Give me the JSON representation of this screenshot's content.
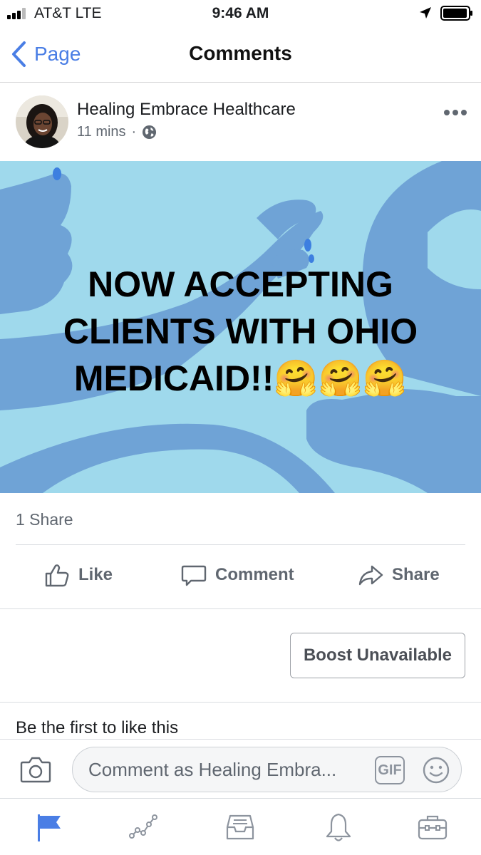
{
  "status_bar": {
    "carrier": "AT&T  LTE",
    "time": "9:46 AM"
  },
  "nav": {
    "back_label": "Page",
    "title": "Comments"
  },
  "post": {
    "page_name": "Healing Embrace Healthcare",
    "time_ago": "11 mins",
    "separator": "·",
    "image_text_lines": [
      "NOW ACCEPTING",
      "CLIENTS WITH OHIO",
      "MEDICAID!!🤗🤗🤗"
    ],
    "share_count": "1 Share"
  },
  "actions": {
    "like": "Like",
    "comment": "Comment",
    "share": "Share"
  },
  "boost": {
    "label": "Boost Unavailable"
  },
  "likes_line": "Be the first to like this",
  "composer": {
    "placeholder": "Comment as Healing Embra...",
    "gif_label": "GIF"
  },
  "tabs": [
    {
      "icon": "flag-icon",
      "active": true
    },
    {
      "icon": "insights-icon",
      "active": false
    },
    {
      "icon": "inbox-icon",
      "active": false
    },
    {
      "icon": "bell-icon",
      "active": false
    },
    {
      "icon": "briefcase-icon",
      "active": false
    }
  ],
  "colors": {
    "accent": "#4a7ee5",
    "image_bg": "#9fd9ec",
    "image_shapes": "#6fa3d6",
    "muted_text": "#606770"
  }
}
